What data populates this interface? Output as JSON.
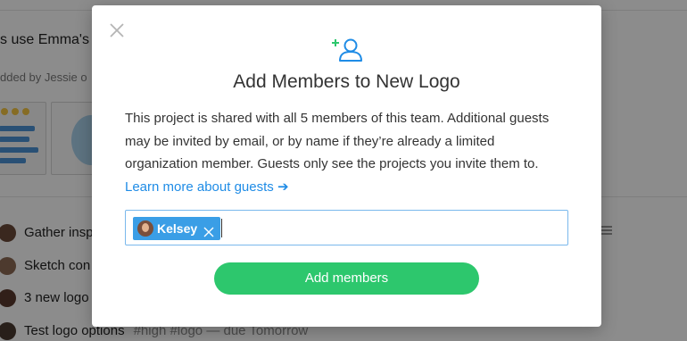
{
  "background": {
    "message": "s use Emma's s",
    "added_by": "dded by Jessie o",
    "tasks": [
      {
        "title": "Gather insp"
      },
      {
        "title": "Sketch con"
      },
      {
        "title": "3 new logo"
      },
      {
        "title": "Test logo options",
        "tags": "#high #logo  — due Tomorrow"
      }
    ]
  },
  "modal": {
    "title": "Add Members to New Logo",
    "description": "This project is shared with all 5 members of this team. Additional guests may be invited by email, or by name if they’re already a limited organization member. Guests only see the projects you invite them to.",
    "learn_more": "Learn more about guests ➔",
    "chips": [
      {
        "name": "Kelsey"
      }
    ],
    "submit_label": "Add members"
  },
  "colors": {
    "accent_blue": "#1f8ce6",
    "chip_blue": "#3a9ee6",
    "button_green": "#2dc76d",
    "icon_plus_green": "#2dc76d"
  },
  "icons": [
    "close-icon",
    "add-user-icon",
    "avatar",
    "remove-chip-icon",
    "list-icon"
  ]
}
